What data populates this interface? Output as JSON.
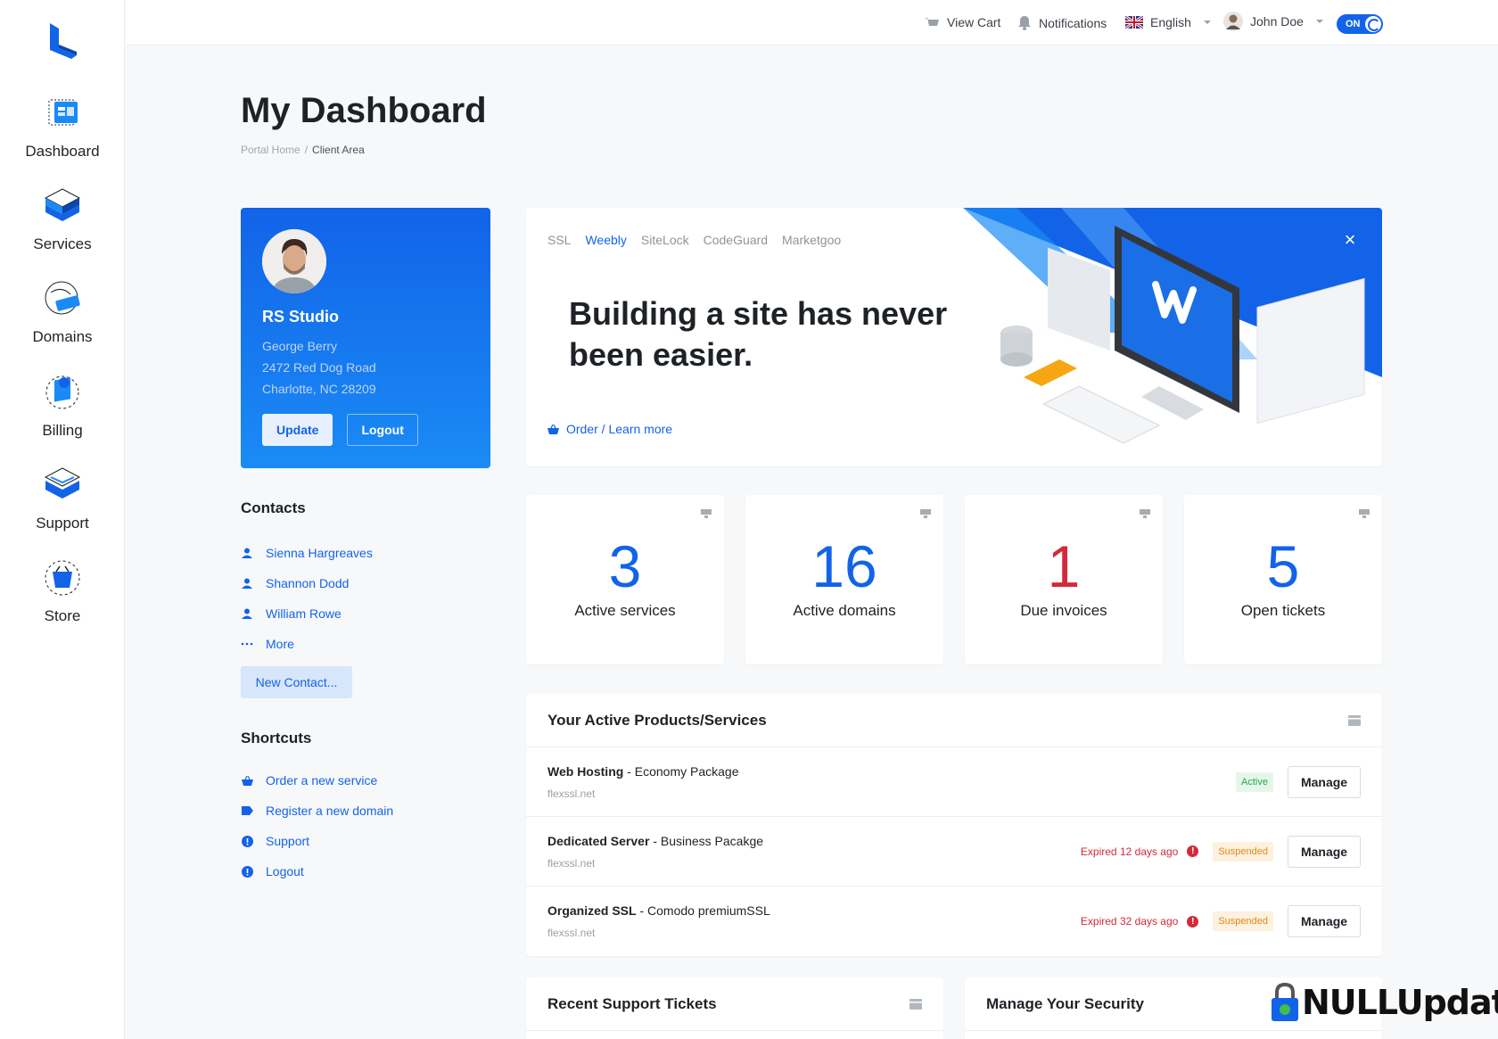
{
  "sidebar": {
    "items": [
      {
        "label": "Dashboard",
        "icon": "dashboard-icon"
      },
      {
        "label": "Services",
        "icon": "services-icon"
      },
      {
        "label": "Domains",
        "icon": "domains-icon"
      },
      {
        "label": "Billing",
        "icon": "billing-icon"
      },
      {
        "label": "Support",
        "icon": "support-icon"
      },
      {
        "label": "Store",
        "icon": "store-icon"
      }
    ]
  },
  "topbar": {
    "cart": "View Cart",
    "notifications": "Notifications",
    "language": "English",
    "user": "John Doe",
    "toggle": "ON"
  },
  "page": {
    "title": "My Dashboard",
    "breadcrumb": {
      "home": "Portal Home",
      "current": "Client Area"
    }
  },
  "profile": {
    "company": "RS Studio",
    "name": "George Berry",
    "address1": "2472 Red Dog Road",
    "address2": "Charlotte, NC 28209",
    "update_label": "Update",
    "logout_label": "Logout"
  },
  "contacts": {
    "heading": "Contacts",
    "items": [
      "Sienna Hargreaves",
      "Shannon Dodd",
      "William Rowe"
    ],
    "more": "More",
    "new_label": "New Contact..."
  },
  "shortcuts": {
    "heading": "Shortcuts",
    "items": [
      "Order a new service",
      "Register a new domain",
      "Support",
      "Logout"
    ]
  },
  "promo": {
    "tabs": [
      "SSL",
      "Weebly",
      "SiteLock",
      "CodeGuard",
      "Marketgoo"
    ],
    "active_tab": "Weebly",
    "headline": "Building a site has never been easier.",
    "link": "Order / Learn more",
    "close": "×"
  },
  "stats": [
    {
      "value": "3",
      "label": "Active services"
    },
    {
      "value": "16",
      "label": "Active domains"
    },
    {
      "value": "1",
      "label": "Due invoices"
    },
    {
      "value": "5",
      "label": "Open tickets"
    }
  ],
  "products": {
    "heading": "Your Active Products/Services",
    "rows": [
      {
        "name": "Web Hosting",
        "plan": "Economy Package",
        "domain": "flexssl.net",
        "expired": "",
        "status": "Active",
        "manage": "Manage"
      },
      {
        "name": "Dedicated Server",
        "plan": "Business Pacakge",
        "domain": "flexssl.net",
        "expired": "Expired 12 days ago",
        "status": "Suspended",
        "manage": "Manage"
      },
      {
        "name": "Organized SSL",
        "plan": "Comodo premiumSSL",
        "domain": "flexssl.net",
        "expired": "Expired 32 days ago",
        "status": "Suspended",
        "manage": "Manage"
      }
    ]
  },
  "bottom": {
    "tickets_heading": "Recent Support Tickets",
    "security_heading": "Manage Your Security"
  },
  "watermark": "NULLUpdate",
  "colors": {
    "accent": "#1263e8",
    "danger": "#d22a3a",
    "success": "#26a652",
    "warning": "#e08a12"
  }
}
